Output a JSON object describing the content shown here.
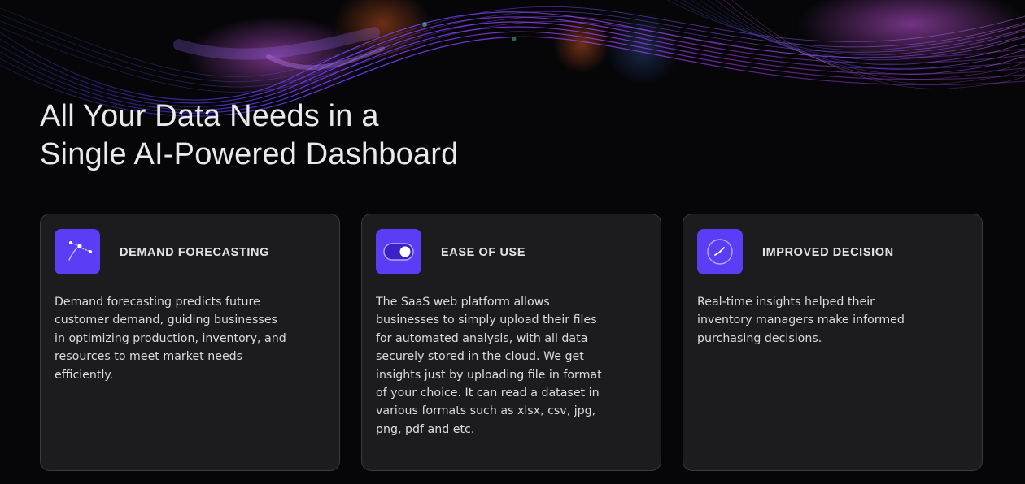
{
  "headline": {
    "line1": "All Your Data Needs in a",
    "line2": "Single AI-Powered Dashboard"
  },
  "colors": {
    "background": "#060608",
    "card_background": "#1c1c1e",
    "card_border": "#3a3a3e",
    "icon_background": "#5b3df5",
    "accent_purple": "#8a3cff"
  },
  "cards": [
    {
      "icon": "forecast-curve-icon",
      "title": "DEMAND FORECASTING",
      "body": "Demand forecasting predicts future customer demand, guiding businesses in optimizing production, inventory, and resources to meet market needs efficiently."
    },
    {
      "icon": "toggle-icon",
      "title": "EASE OF USE",
      "body": "The SaaS web platform allows businesses to simply upload their files for automated analysis, with all data securely stored in the cloud. We get insights just by uploading file in format of your choice. It can read a dataset in various formats such as xlsx, csv, jpg, png, pdf and etc."
    },
    {
      "icon": "gauge-icon",
      "title": "IMPROVED DECISION",
      "body": "Real-time insights helped their inventory managers make informed purchasing decisions."
    }
  ]
}
